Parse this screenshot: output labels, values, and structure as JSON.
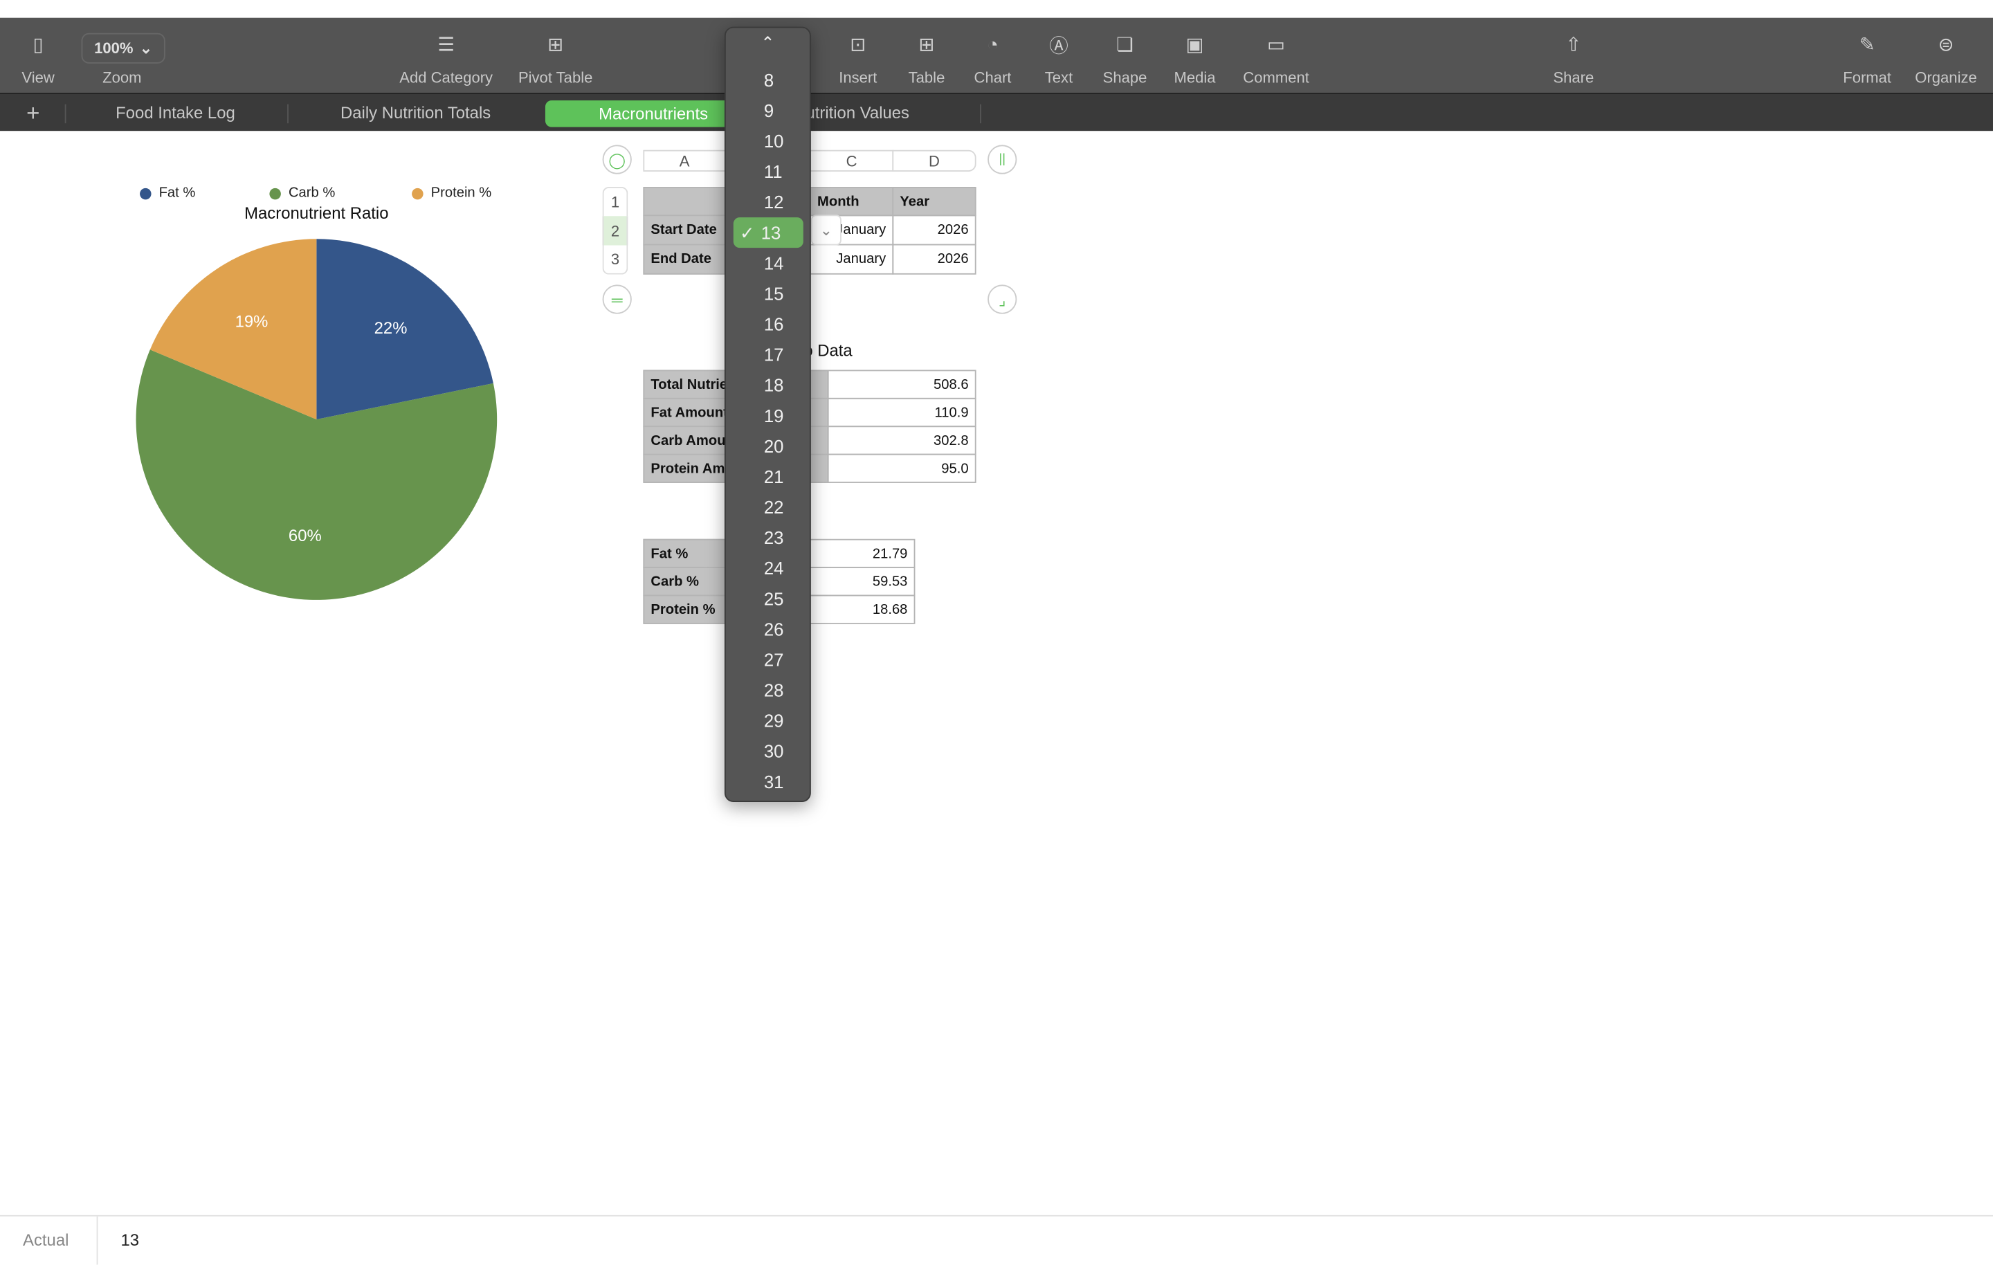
{
  "toolbar": {
    "zoom_value": "100%",
    "items": [
      {
        "label": "View",
        "icon": "sidebar-icon"
      },
      {
        "label": "Zoom",
        "icon": "zoom-icon"
      },
      {
        "label": "Add Category",
        "icon": "list-icon"
      },
      {
        "label": "Pivot Table",
        "icon": "pivot-table-icon"
      },
      {
        "label": "Insert",
        "icon": "insert-icon"
      },
      {
        "label": "Table",
        "icon": "table-icon"
      },
      {
        "label": "Chart",
        "icon": "chart-icon"
      },
      {
        "label": "Text",
        "icon": "text-icon"
      },
      {
        "label": "Shape",
        "icon": "shape-icon"
      },
      {
        "label": "Media",
        "icon": "media-icon"
      },
      {
        "label": "Comment",
        "icon": "comment-icon"
      },
      {
        "label": "Share",
        "icon": "share-icon"
      },
      {
        "label": "Format",
        "icon": "format-brush-icon"
      },
      {
        "label": "Organize",
        "icon": "organize-icon"
      }
    ]
  },
  "sheets": {
    "add": "+",
    "tabs": [
      "Food Intake Log",
      "Daily Nutrition Totals",
      "Macronutrients",
      "Nutrition Values"
    ],
    "active": "Macronutrients"
  },
  "chart_data": {
    "type": "pie",
    "title": "Macronutrient Ratio",
    "legend_position": "top",
    "categories": [
      "Fat %",
      "Carb %",
      "Protein %"
    ],
    "values": [
      21.79,
      59.53,
      18.68
    ],
    "labels": [
      "22%",
      "60%",
      "19%"
    ],
    "colors": [
      "#34568a",
      "#67944d",
      "#e0a24e"
    ]
  },
  "table1": {
    "columns": [
      "A",
      "C",
      "D"
    ],
    "rows": [
      "1",
      "2",
      "3"
    ],
    "header": [
      "Month",
      "Year"
    ],
    "data": [
      {
        "label": "Start Date",
        "month": "January",
        "year": "2026"
      },
      {
        "label": "End Date",
        "month": "January",
        "year": "2026"
      }
    ]
  },
  "table2": {
    "title": "Macro Data",
    "rows": [
      {
        "label": "Total Nutrients",
        "value": "508.6"
      },
      {
        "label": "Fat Amount",
        "value": "110.9"
      },
      {
        "label": "Carb Amount",
        "value": "302.8"
      },
      {
        "label": "Protein Amount",
        "value": "95.0"
      }
    ]
  },
  "table3": {
    "rows": [
      {
        "label": "Fat %",
        "value": "21.79"
      },
      {
        "label": "Carb %",
        "value": "59.53"
      },
      {
        "label": "Protein %",
        "value": "18.68"
      }
    ]
  },
  "dropdown": {
    "scroll_up": "⌃",
    "options": [
      "8",
      "9",
      "10",
      "11",
      "12",
      "13",
      "14",
      "15",
      "16",
      "17",
      "18",
      "19",
      "20",
      "21",
      "22",
      "23",
      "24",
      "25",
      "26",
      "27",
      "28",
      "29",
      "30",
      "31"
    ],
    "selected": "13",
    "check": "✓"
  },
  "formula_bar": {
    "label": "Actual",
    "value": "13"
  }
}
